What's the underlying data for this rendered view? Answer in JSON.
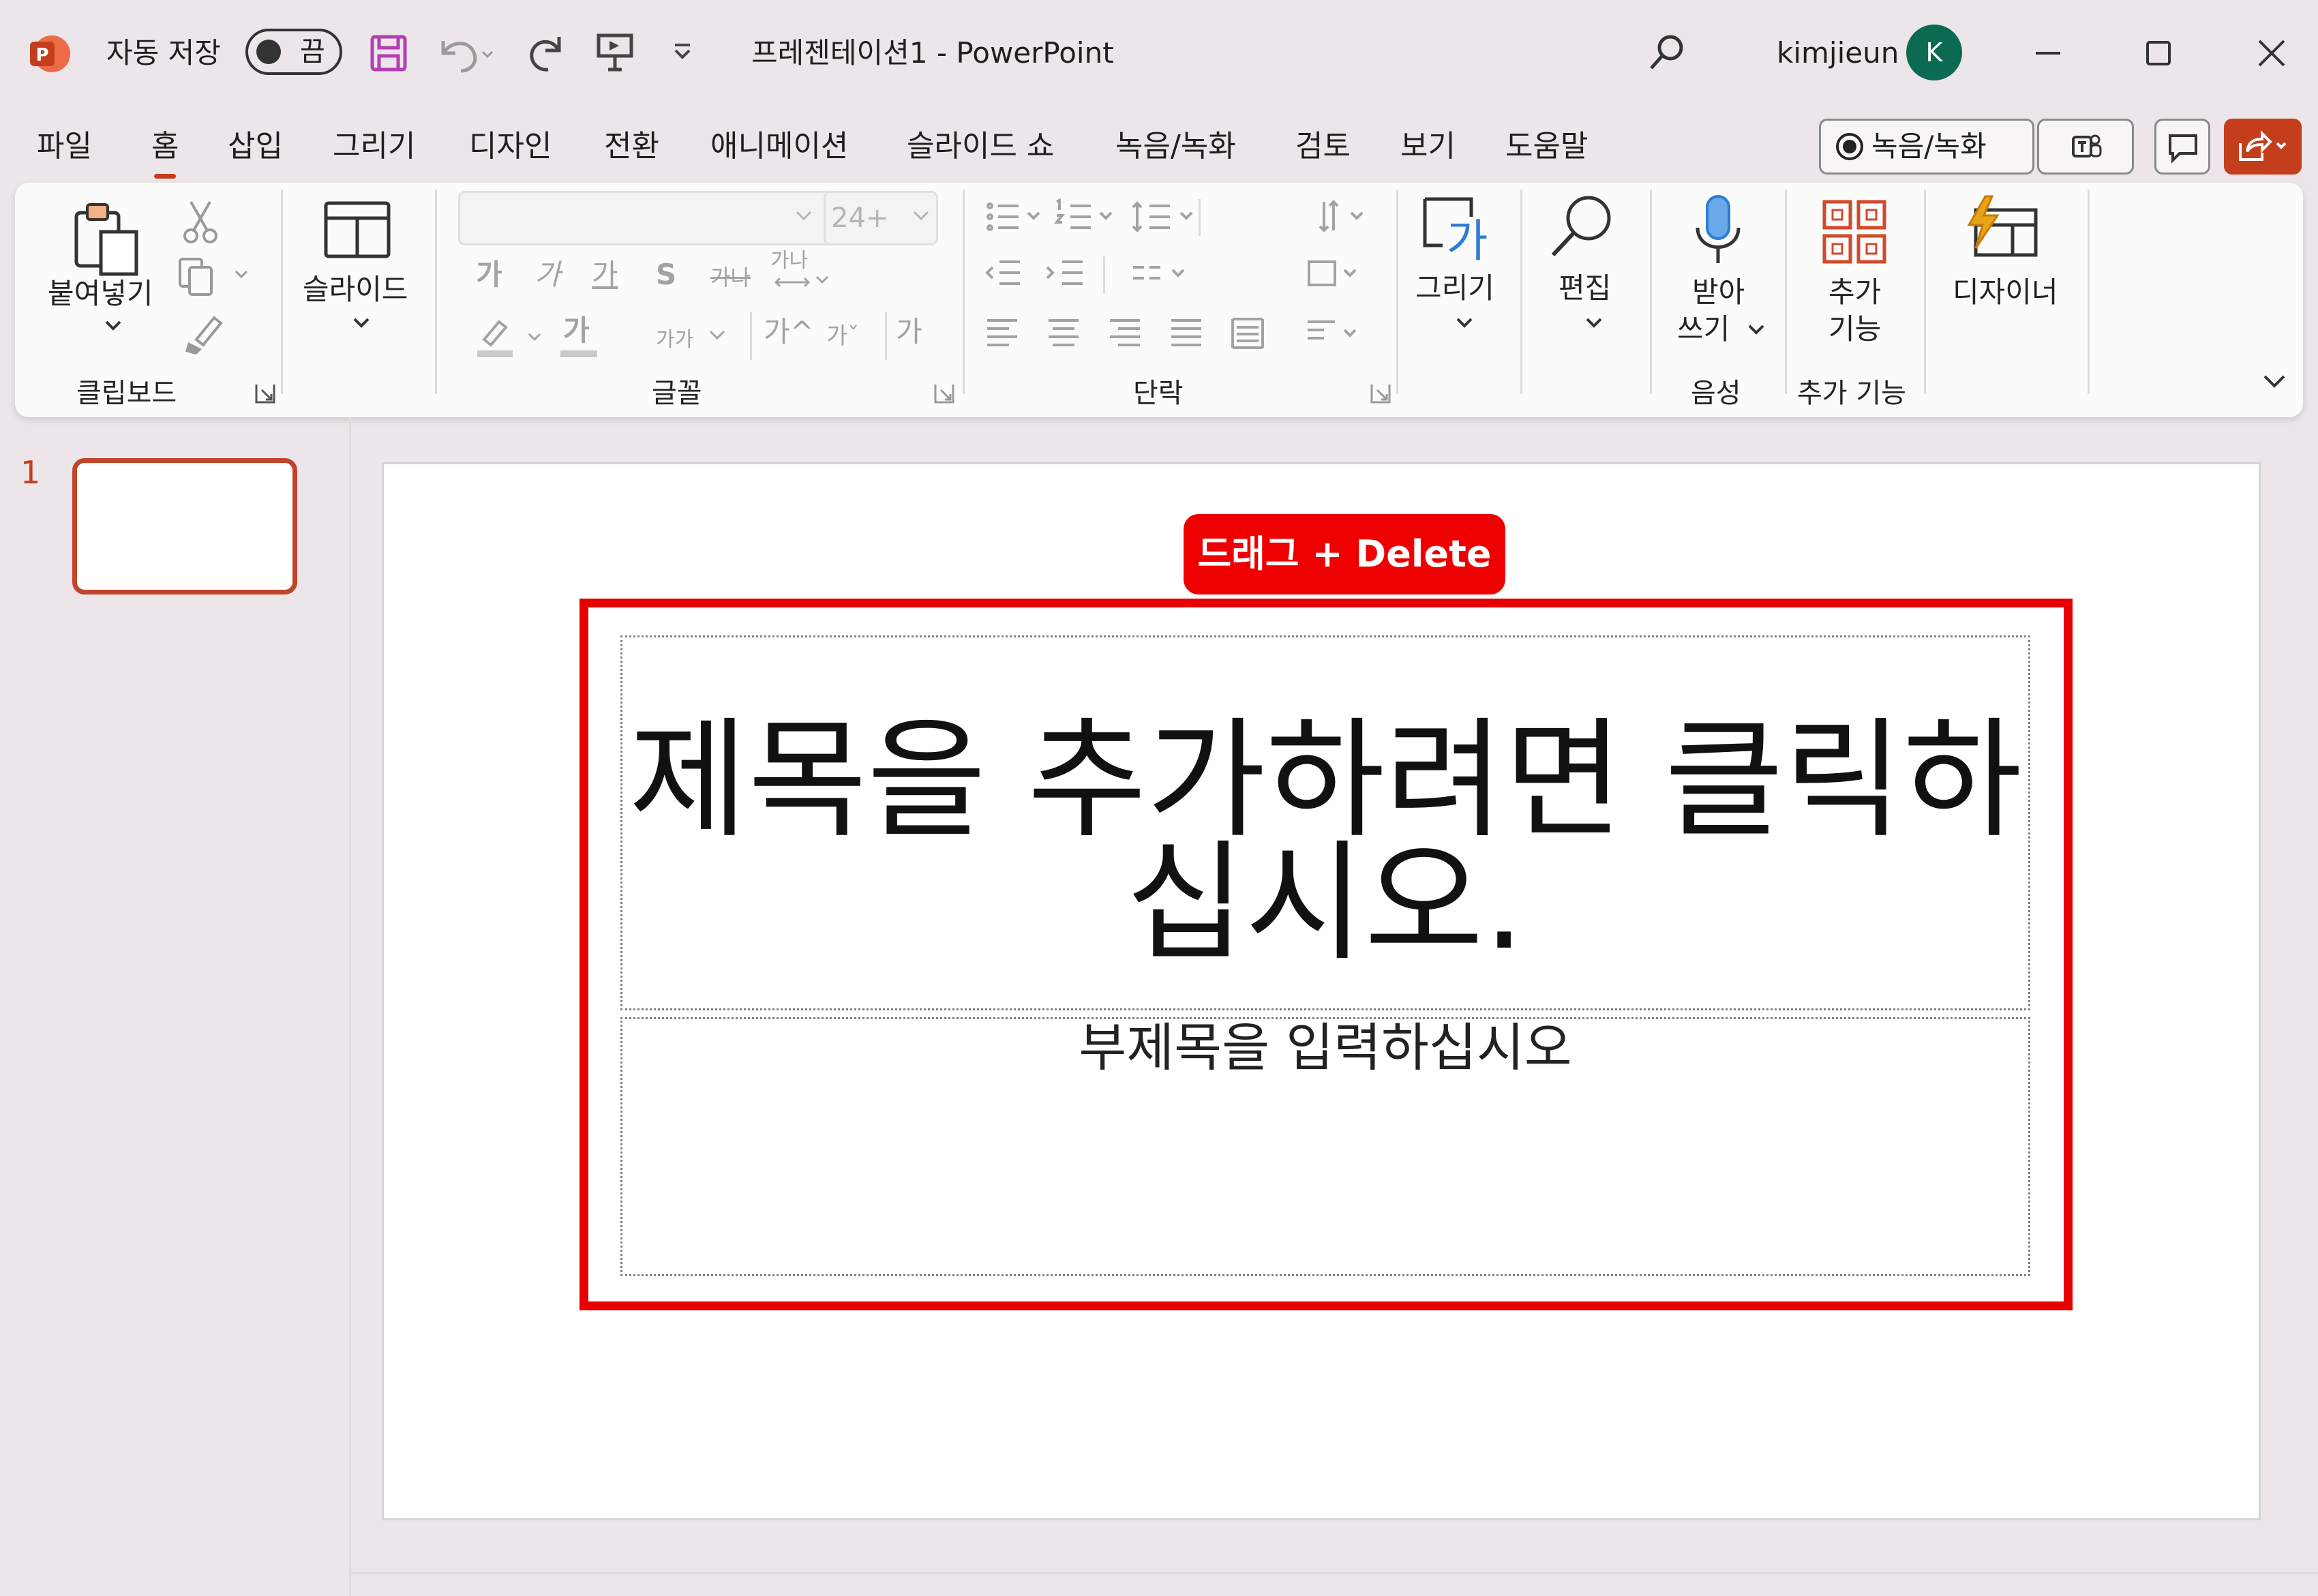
{
  "window": {
    "autosave_label": "자동 저장",
    "autosave_state": "끔",
    "doc_title": "프레젠테이션1  -  PowerPoint",
    "user_name": "kimjieun",
    "avatar_initial": "K"
  },
  "menu": {
    "tabs": [
      "파일",
      "홈",
      "삽입",
      "그리기",
      "디자인",
      "전환",
      "애니메이션",
      "슬라이드 쇼",
      "녹음/녹화",
      "검토",
      "보기",
      "도움말"
    ],
    "active_tab": "홈",
    "record_button": "녹음/녹화"
  },
  "ribbon": {
    "clipboard": {
      "paste": "붙여넣기",
      "group": "클립보드"
    },
    "slides": {
      "slide": "슬라이드"
    },
    "font": {
      "font_size": "24+",
      "row1": [
        "가",
        "가",
        "가",
        "S",
        "가나",
        "가나"
      ],
      "row2": [
        "가",
        "가가",
        "가^",
        "가ˇ",
        "가"
      ],
      "group": "글꼴"
    },
    "paragraph": {
      "group": "단락"
    },
    "drawing": {
      "label": "그리기",
      "icon_glyph": "가"
    },
    "editing": {
      "label": "편집"
    },
    "voice": {
      "label_line1": "받아",
      "label_line2": "쓰기",
      "group": "음성"
    },
    "addins": {
      "label_line1": "추가",
      "label_line2": "기능",
      "group": "추가 기능"
    },
    "designer": {
      "label": "디자이너"
    }
  },
  "thumbnails": {
    "number": "1"
  },
  "slide": {
    "callout": "드래그 + Delete",
    "title_line1": "제목을 추가하려면 클릭하",
    "title_line2": "십시오.",
    "subtitle": "부제목을 입력하십시오"
  },
  "colors": {
    "accent": "#c43e1c",
    "callout_bg": "#ee0000",
    "highlight_frame": "#e60000",
    "avatar_bg": "#0b6a52",
    "drawing_icon": "#2b7cd3",
    "designer_bolt": "#e8a317"
  }
}
